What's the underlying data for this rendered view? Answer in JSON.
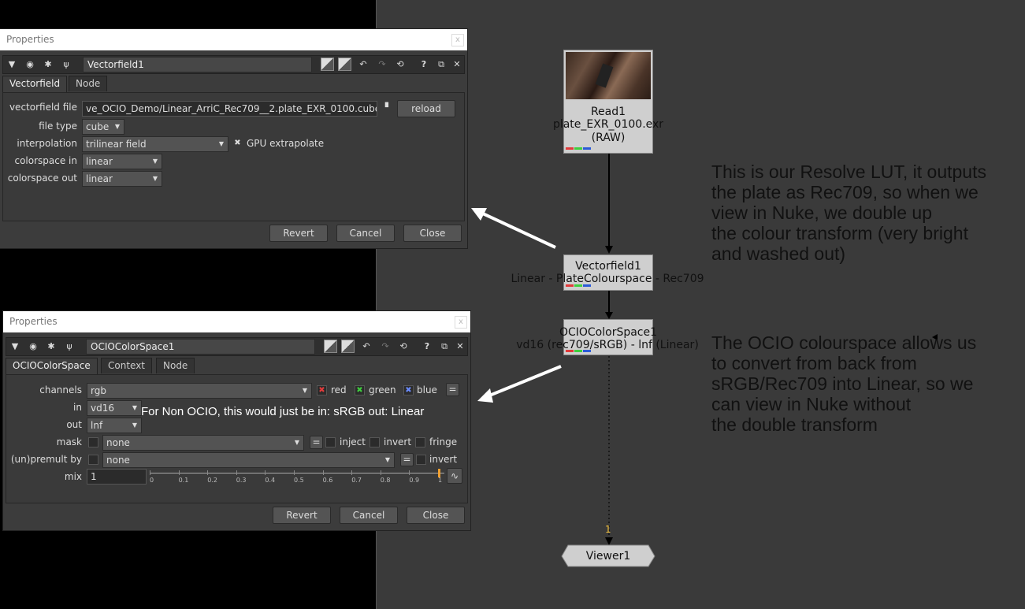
{
  "panel1": {
    "title": "Properties",
    "close_glyph": "x",
    "node_name": "Vectorfield1",
    "tabs": [
      "Vectorfield",
      "Node"
    ],
    "fields": {
      "vectorfield_file_label": "vectorfield file",
      "vectorfield_file_value": "ve_OCIO_Demo/Linear_ArriC_Rec709__2.plate_EXR_0100.cube",
      "reload_label": "reload",
      "file_type_label": "file type",
      "file_type_value": "cube",
      "interpolation_label": "interpolation",
      "interpolation_value": "trilinear field",
      "gpu_extrapolate_label": "GPU extrapolate",
      "colorspace_in_label": "colorspace in",
      "colorspace_in_value": "linear",
      "colorspace_out_label": "colorspace out",
      "colorspace_out_value": "linear"
    },
    "buttons": {
      "revert": "Revert",
      "cancel": "Cancel",
      "close": "Close"
    }
  },
  "panel2": {
    "title": "Properties",
    "close_glyph": "x",
    "node_name": "OCIOColorSpace1",
    "tabs": [
      "OCIOColorSpace",
      "Context",
      "Node"
    ],
    "fields": {
      "channels_label": "channels",
      "channels_value": "rgb",
      "red_label": "red",
      "green_label": "green",
      "blue_label": "blue",
      "eq_glyph": "=",
      "in_label": "in",
      "in_value": "vd16",
      "out_label": "out",
      "out_value": "lnf",
      "mask_label": "mask",
      "mask_value": "none",
      "inject_label": "inject",
      "invert_label": "invert",
      "fringe_label": "fringe",
      "premult_label": "(un)premult by",
      "premult_value": "none",
      "premult_invert_label": "invert",
      "mix_label": "mix",
      "mix_value": "1",
      "slider_ticks": [
        "0",
        "0.1",
        "0.2",
        "0.3",
        "0.4",
        "0.5",
        "0.6",
        "0.7",
        "0.8",
        "0.9",
        "1"
      ],
      "mix_fraction": 1.0
    },
    "note": "For Non OCIO, this would just be in: sRGB out: Linear",
    "buttons": {
      "revert": "Revert",
      "cancel": "Cancel",
      "close": "Close"
    }
  },
  "graph": {
    "read_node": {
      "name": "Read1",
      "file": "plate_EXR_0100.exr",
      "colorspace": "(RAW)"
    },
    "vectorfield_node": {
      "name": "Vectorfield1",
      "label": "Linear - PlateColourspace - Rec709"
    },
    "ocio_node": {
      "name": "OCIOColorSpace1",
      "label": "vd16 (rec709/sRGB) - lnf (Linear)"
    },
    "viewer_node": {
      "name": "Viewer1",
      "input_number": "1"
    }
  },
  "annotations": {
    "resolve_lut": [
      "This is our Resolve LUT, it outputs",
      "the plate as Rec709, so when we",
      "view in Nuke, we double up",
      "the colour transform (very bright",
      "and washed out)"
    ],
    "ocio": [
      "The OCIO colourspace allows us",
      "to convert from back from",
      "sRGB/Rec709 into Linear, so we",
      "can view in Nuke without",
      "the double transform"
    ]
  },
  "colors": {
    "channel_red": "#e23b3b",
    "channel_green": "#3fcf3f",
    "channel_blue": "#2b5bd8",
    "dag_bg": "#3a3a3a",
    "node_bg": "#cfcfcf"
  }
}
